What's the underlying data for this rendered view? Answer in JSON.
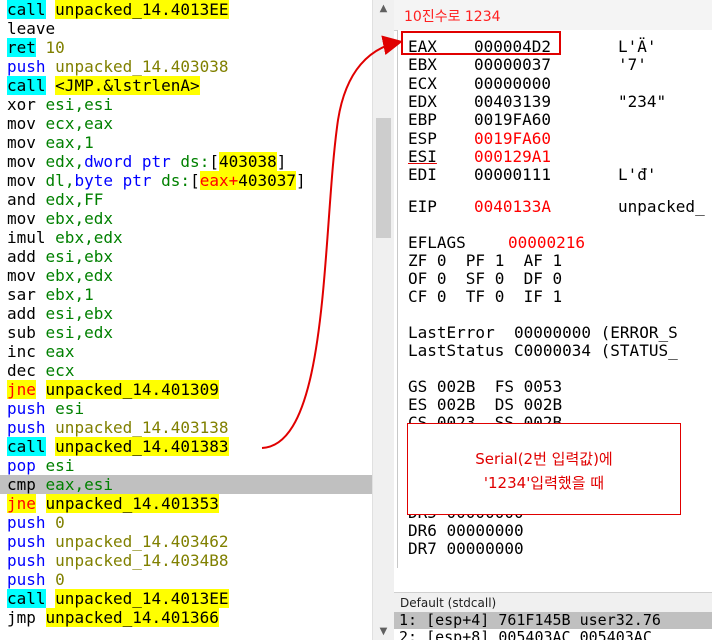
{
  "disassembly": [
    {
      "mnemonic": "call",
      "kind": "call",
      "operand": "unpacked_14.4013EE",
      "operand_kind": "yellow"
    },
    {
      "mnemonic": "leave",
      "kind": "plain",
      "operand": "",
      "operand_kind": "plain"
    },
    {
      "mnemonic": "ret",
      "kind": "ret",
      "operand": "10",
      "operand_kind": "op"
    },
    {
      "mnemonic": "push",
      "kind": "push",
      "operand": "unpacked_14.403038",
      "operand_kind": "op"
    },
    {
      "mnemonic": "call",
      "kind": "call",
      "operand": "<JMP.&lstrlenA>",
      "operand_kind": "yellow"
    },
    {
      "mnemonic": "xor",
      "kind": "plain",
      "operand": "esi,esi",
      "operand_kind": "reg"
    },
    {
      "mnemonic": "mov",
      "kind": "plain",
      "operand": "ecx,eax",
      "operand_kind": "reg"
    },
    {
      "mnemonic": "mov",
      "kind": "plain",
      "operand": "eax,1",
      "operand_kind": "reg"
    },
    {
      "mnemonic": "mov",
      "kind": "plain",
      "operand": "edx,dword ptr ds:[403038]",
      "operand_kind": "mem1"
    },
    {
      "mnemonic": "mov",
      "kind": "plain",
      "operand": "dl,byte ptr ds:[eax+403037]",
      "operand_kind": "mem2"
    },
    {
      "mnemonic": "and",
      "kind": "plain",
      "operand": "edx,FF",
      "operand_kind": "reg"
    },
    {
      "mnemonic": "mov",
      "kind": "plain",
      "operand": "ebx,edx",
      "operand_kind": "reg"
    },
    {
      "mnemonic": "imul",
      "kind": "plain",
      "operand": "ebx,edx",
      "operand_kind": "reg"
    },
    {
      "mnemonic": "add",
      "kind": "plain",
      "operand": "esi,ebx",
      "operand_kind": "reg"
    },
    {
      "mnemonic": "mov",
      "kind": "plain",
      "operand": "ebx,edx",
      "operand_kind": "reg"
    },
    {
      "mnemonic": "sar",
      "kind": "plain",
      "operand": "ebx,1",
      "operand_kind": "reg"
    },
    {
      "mnemonic": "add",
      "kind": "plain",
      "operand": "esi,ebx",
      "operand_kind": "reg"
    },
    {
      "mnemonic": "sub",
      "kind": "plain",
      "operand": "esi,edx",
      "operand_kind": "reg"
    },
    {
      "mnemonic": "inc",
      "kind": "plain",
      "operand": "eax",
      "operand_kind": "reg"
    },
    {
      "mnemonic": "dec",
      "kind": "plain",
      "operand": "ecx",
      "operand_kind": "reg"
    },
    {
      "mnemonic": "jne",
      "kind": "jcc",
      "operand": "unpacked_14.401309",
      "operand_kind": "yellow"
    },
    {
      "mnemonic": "push",
      "kind": "push",
      "operand": "esi",
      "operand_kind": "reg"
    },
    {
      "mnemonic": "push",
      "kind": "push",
      "operand": "unpacked_14.403138",
      "operand_kind": "op"
    },
    {
      "mnemonic": "call",
      "kind": "call",
      "operand": "unpacked_14.401383",
      "operand_kind": "yellow"
    },
    {
      "mnemonic": "pop",
      "kind": "pop",
      "operand": "esi",
      "operand_kind": "reg"
    },
    {
      "mnemonic": "cmp",
      "kind": "plain",
      "operand": "eax,esi",
      "operand_kind": "reg",
      "selected": true
    },
    {
      "mnemonic": "jne",
      "kind": "jcc",
      "operand": "unpacked_14.401353",
      "operand_kind": "yellow"
    },
    {
      "mnemonic": "push",
      "kind": "push",
      "operand": "0",
      "operand_kind": "op"
    },
    {
      "mnemonic": "push",
      "kind": "push",
      "operand": "unpacked_14.403462",
      "operand_kind": "op"
    },
    {
      "mnemonic": "push",
      "kind": "push",
      "operand": "unpacked_14.4034B8",
      "operand_kind": "op"
    },
    {
      "mnemonic": "push",
      "kind": "push",
      "operand": "0",
      "operand_kind": "op"
    },
    {
      "mnemonic": "call",
      "kind": "call",
      "operand": "unpacked_14.4013EE",
      "operand_kind": "yellow"
    },
    {
      "mnemonic": "jmp",
      "kind": "plain",
      "operand": "unpacked_14.401366",
      "operand_kind": "yellow"
    }
  ],
  "registers": {
    "caption": "10진수로 1234",
    "general": [
      {
        "name": "EAX",
        "value": "000004D2",
        "comment": "L'Ӓ'",
        "red": false,
        "underline": true
      },
      {
        "name": "EBX",
        "value": "00000037",
        "comment": "'7'",
        "red": false
      },
      {
        "name": "ECX",
        "value": "00000000",
        "comment": "",
        "red": false
      },
      {
        "name": "EDX",
        "value": "00403139",
        "comment": "\"234\"",
        "red": false
      },
      {
        "name": "EBP",
        "value": "0019FA60",
        "comment": "",
        "red": false
      },
      {
        "name": "ESP",
        "value": "0019FA60",
        "comment": "",
        "red": true
      },
      {
        "name": "ESI",
        "value": "000129A1",
        "comment": "",
        "red": true,
        "underline": true
      },
      {
        "name": "EDI",
        "value": "00000111",
        "comment": "L'đ'",
        "red": false
      }
    ],
    "eip": {
      "name": "EIP",
      "value": "0040133A",
      "comment": "unpacked_"
    },
    "eflags": {
      "name": "EFLAGS",
      "value": "00000216"
    },
    "flags_rows": [
      "ZF 0  PF 1  AF 1",
      "OF 0  SF 0  DF 0",
      "CF 0  TF 0  IF 1"
    ],
    "last_error": "LastError  00000000 (ERROR_S",
    "last_status": "LastStatus C0000034 (STATUS_",
    "segments": [
      "GS 002B  FS 0053",
      "ES 002B  DS 002B",
      "CS 0023  SS 002B"
    ],
    "debug_regs": [
      "DR5 00000000",
      "DR6 00000000",
      "DR7 00000000"
    ]
  },
  "annotation": {
    "line1": "Serial(2번 입력값)에",
    "line2": "'1234'입력했을 때"
  },
  "stack": {
    "header": "Default (stdcall)",
    "rows": [
      "1: [esp+4] 761F145B user32.76",
      "2: [esp+8] 005403AC 005403AC"
    ]
  },
  "colors": {
    "annotation_red": "#e00000",
    "call_bg": "#00ffff",
    "jump_bg": "#ffff00",
    "selected_row": "#c0c0c0"
  }
}
